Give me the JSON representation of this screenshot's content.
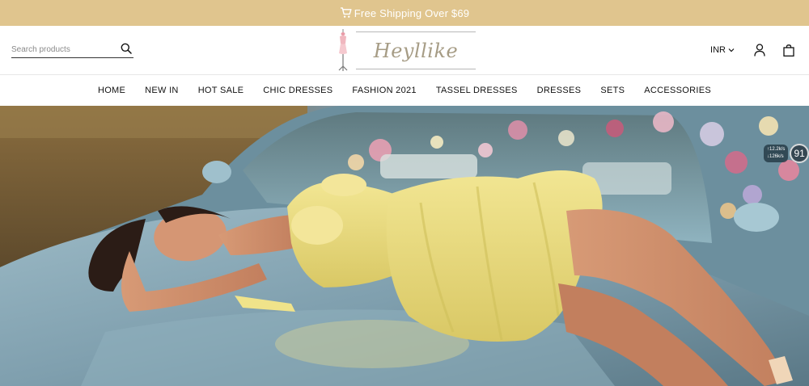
{
  "announcement": {
    "text": "Free Shipping Over $69",
    "icon": "cart-icon"
  },
  "search": {
    "placeholder": "Search products",
    "icon": "search-icon"
  },
  "logo": {
    "text": "Heyllike"
  },
  "header": {
    "currency": "INR",
    "user_icon": "user-icon",
    "bag_icon": "bag-icon"
  },
  "nav": {
    "items": [
      {
        "label": "HOME"
      },
      {
        "label": "NEW IN"
      },
      {
        "label": "HOT SALE"
      },
      {
        "label": "CHIC DRESSES"
      },
      {
        "label": "FASHION 2021"
      },
      {
        "label": "TASSEL DRESSES"
      },
      {
        "label": "DRESSES"
      },
      {
        "label": "SETS"
      },
      {
        "label": "ACCESSORIES"
      }
    ]
  },
  "hero": {
    "badge": {
      "up": "↑12.2k/s",
      "down": "↓126k/s",
      "value": "91"
    }
  },
  "colors": {
    "announcement_bg": "#e0c58e",
    "logo_text": "#a69c85",
    "dress": "#ece07e"
  }
}
